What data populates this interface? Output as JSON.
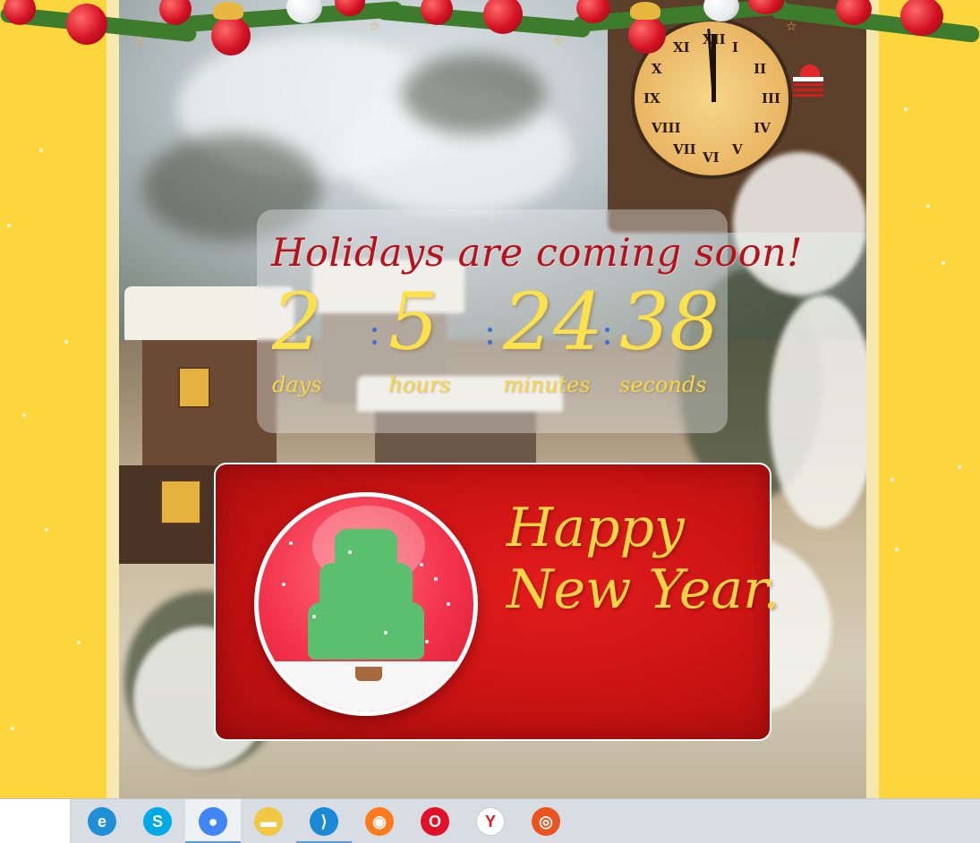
{
  "countdown": {
    "title": "Holidays are coming soon!",
    "days": "2",
    "hours": "5",
    "minutes": "24",
    "seconds": "38",
    "days_label": "days",
    "hours_label": "hours",
    "minutes_label": "minutes",
    "seconds_label": "seconds"
  },
  "card": {
    "greeting": "Happy\nNew Year."
  },
  "clock_numerals": [
    "XII",
    "I",
    "II",
    "III",
    "IV",
    "V",
    "VI",
    "VII",
    "VIII",
    "IX",
    "X",
    "XI"
  ],
  "taskbar": {
    "apps": [
      {
        "name": "edge-icon",
        "color": "#1f8fd6",
        "glyph": "e"
      },
      {
        "name": "skype-icon",
        "color": "#00a8e6",
        "glyph": "S"
      },
      {
        "name": "chrome-icon",
        "color": "#4285f4",
        "glyph": "●"
      },
      {
        "name": "file-explorer-icon",
        "color": "#f2c744",
        "glyph": "▬"
      },
      {
        "name": "vscode-icon",
        "color": "#1a8ad4",
        "glyph": "⟩"
      },
      {
        "name": "firefox-icon",
        "color": "#ff7a1f",
        "glyph": "◉"
      },
      {
        "name": "opera-icon",
        "color": "#e3102a",
        "glyph": "O"
      },
      {
        "name": "yandex-browser-icon",
        "color": "#ffffff",
        "glyph": "Y"
      },
      {
        "name": "ubuntu-icon",
        "color": "#e95420",
        "glyph": "◎"
      }
    ]
  },
  "colors": {
    "page_background": "#fdd63e",
    "title_red": "#b5121b",
    "digit_yellow": "#fbe14b",
    "card_red": "#c81313",
    "colon_blue": "#3d6bd8"
  }
}
